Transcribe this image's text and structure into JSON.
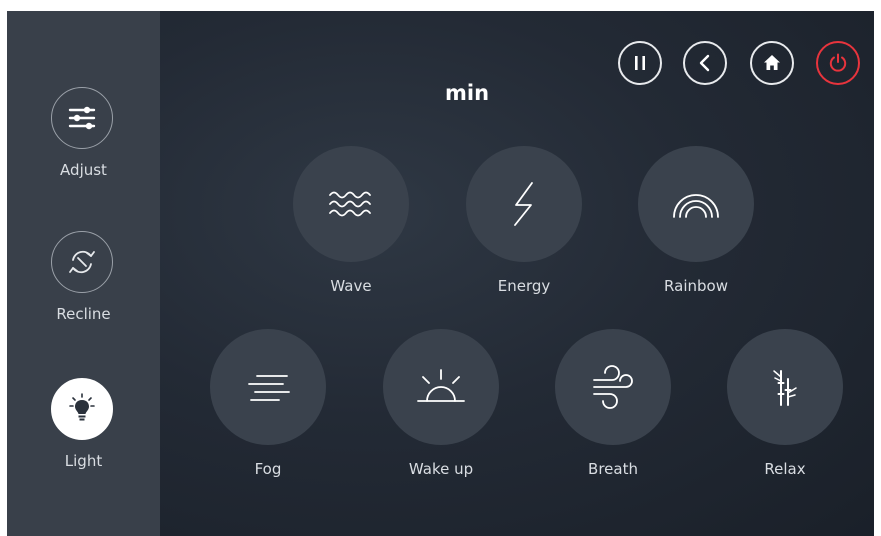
{
  "sidebar": {
    "items": [
      {
        "label": "Adjust",
        "icon": "sliders-icon"
      },
      {
        "label": "Recline",
        "icon": "recline-icon"
      },
      {
        "label": "Light",
        "icon": "lightbulb-icon",
        "active": true
      }
    ]
  },
  "header": {
    "title": "min",
    "buttons": [
      "pause-icon",
      "back-icon",
      "home-icon",
      "power-icon"
    ]
  },
  "modes": [
    {
      "label": "Wave",
      "icon": "wave-icon"
    },
    {
      "label": "Energy",
      "icon": "lightning-icon"
    },
    {
      "label": "Rainbow",
      "icon": "rainbow-icon"
    },
    {
      "label": "Fog",
      "icon": "fog-icon"
    },
    {
      "label": "Wake up",
      "icon": "sunrise-icon"
    },
    {
      "label": "Breath",
      "icon": "wind-icon"
    },
    {
      "label": "Relax",
      "icon": "bamboo-icon"
    }
  ],
  "colors": {
    "background": "#232a35",
    "sidebar": "#39404a",
    "circle": "#3a424d",
    "power": "#e8343d"
  }
}
